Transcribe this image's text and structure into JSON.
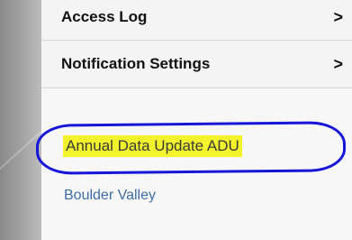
{
  "menu": {
    "items": [
      {
        "label": "Access Log",
        "chevron": ">"
      },
      {
        "label": "Notification Settings",
        "chevron": ">"
      }
    ]
  },
  "links": {
    "highlighted": {
      "label": "Annual Data Update ADU",
      "highlight_color": "#f3f32b",
      "ring_color": "#1616d8"
    },
    "secondary": {
      "label": "Boulder Valley",
      "color": "#3e6ea8"
    }
  }
}
